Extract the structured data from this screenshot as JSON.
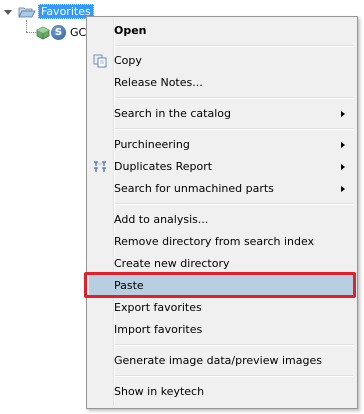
{
  "tree": {
    "root_label": "Favorites",
    "child_label": "GC",
    "child_badge_letter": "S"
  },
  "menu": {
    "items": [
      {
        "label": "Open",
        "bold": true
      },
      {
        "label": "Copy",
        "icon": "copy-icon"
      },
      {
        "label": "Release Notes..."
      },
      {
        "label": "Search in the catalog",
        "submenu": true
      },
      {
        "label": "Purchineering",
        "submenu": true
      },
      {
        "label": "Duplicates Report",
        "submenu": true,
        "icon": "duplicates-icon"
      },
      {
        "label": "Search for unmachined parts",
        "submenu": true
      },
      {
        "label": "Add to analysis..."
      },
      {
        "label": "Remove directory from search index"
      },
      {
        "label": "Create new directory"
      },
      {
        "label": "Paste",
        "highlighted": true
      },
      {
        "label": "Export favorites"
      },
      {
        "label": "Import favorites"
      },
      {
        "label": "Generate image data/preview images"
      },
      {
        "label": "Show in keytech"
      }
    ]
  },
  "colors": {
    "selection": "#3399ff",
    "menu_background": "#f0f0f0",
    "hover_highlight": "#b7cfe0",
    "focus_outline": "#e0202a"
  }
}
